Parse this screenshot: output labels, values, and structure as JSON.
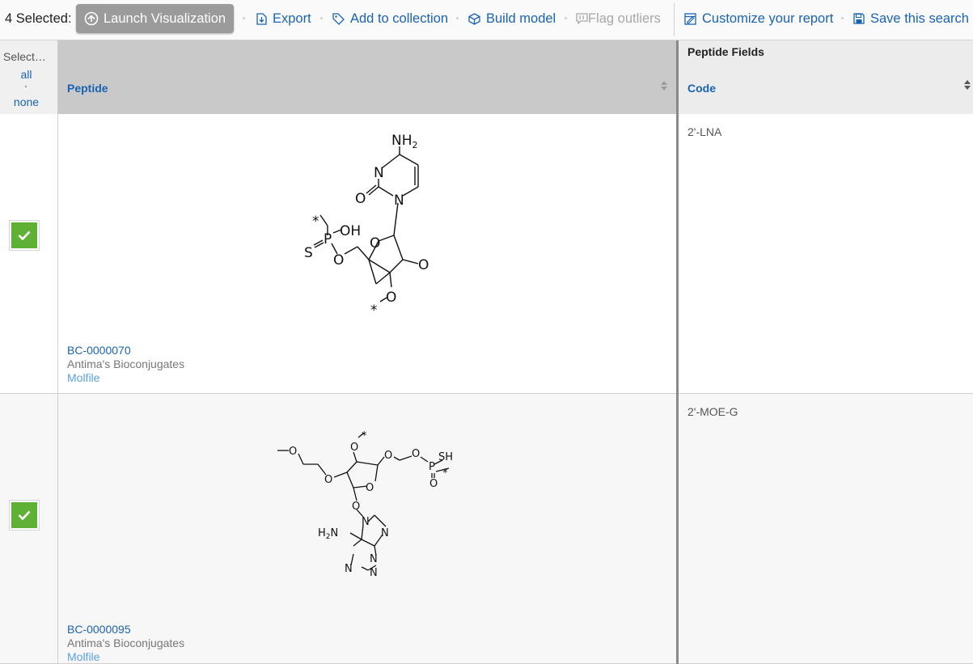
{
  "toolbar": {
    "selected_count": "4 Selected:",
    "launch_label": "Launch Visualization",
    "export_label": "Export",
    "add_collection_label": "Add to collection",
    "build_model_label": "Build model",
    "flag_outliers_label": "Flag outliers",
    "customize_label": "Customize your report",
    "save_search_label": "Save this search"
  },
  "header": {
    "select_label": "Select…",
    "select_all": "all",
    "select_none": "none",
    "peptide_col": "Peptide",
    "fields_group": "Peptide Fields",
    "code_col": "Code"
  },
  "rows": [
    {
      "selected": true,
      "id": "BC-0000070",
      "source": "Antima's Bioconjugates",
      "molfile": "Molfile",
      "code": "2'-LNA",
      "atoms": {
        "nh2": "NH",
        "sub2": "2",
        "n": "N",
        "o": "O",
        "oh": "OH",
        "s": "S",
        "p": "P",
        "star": "*"
      }
    },
    {
      "selected": true,
      "id": "BC-0000095",
      "source": "Antima's Bioconjugates",
      "molfile": "Molfile",
      "code": "2'-MOE-G",
      "atoms": {
        "sh": "SH",
        "h2n": "H",
        "n_label": "N",
        "sub2": "2",
        "n": "N",
        "o": "O",
        "p": "P",
        "star": "*"
      }
    }
  ],
  "colors": {
    "link": "#1a63b3",
    "checkbox": "#5eb135",
    "header_peptide_bg": "#c9c9c9",
    "launch_bg": "#9b9b9b"
  }
}
